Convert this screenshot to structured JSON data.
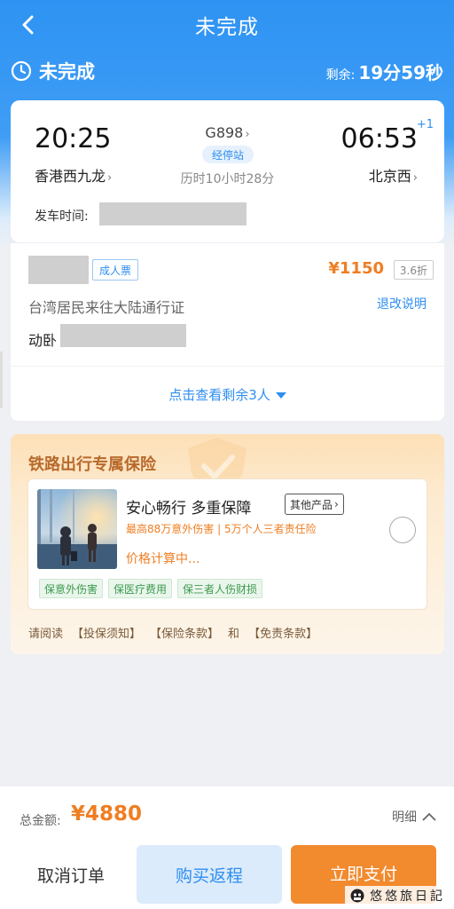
{
  "nav": {
    "title": "未完成"
  },
  "status": {
    "text": "未完成",
    "remaining_label": "剩余:",
    "remaining_value": "19分59秒"
  },
  "trip": {
    "depart_time": "20:25",
    "depart_station": "香港西九龙",
    "train_no": "G898",
    "stops_label": "经停站",
    "duration": "历时10小时28分",
    "arrive_time": "06:53",
    "arrive_day_offset": "+1",
    "arrive_station": "北京西",
    "depart_time_label": "发车时间:"
  },
  "passenger": {
    "ticket_type": "成人票",
    "price": "¥1150",
    "discount": "3.6折",
    "id_type": "台湾居民来往大陆通行证",
    "refund_label": "退改说明",
    "seat_type": "动卧",
    "more_label": "点击查看剩余3人"
  },
  "insurance": {
    "title": "铁路出行专属保险",
    "product_name": "安心畅行 多重保障",
    "other_label": "其他产品",
    "coverage": "最高88万意外伤害 | 5万个人三者责任险",
    "calc_text": "价格计算中...",
    "tags": [
      "保意外伤害",
      "保医疗费用",
      "保三者人伤财损"
    ],
    "read_prefix": "请阅读",
    "link1": "【投保须知】",
    "link2": "【保险条款】",
    "and": "和",
    "link3": "【免责条款】"
  },
  "footer": {
    "total_label": "总金额:",
    "total_value": "¥4880",
    "detail_label": "明细",
    "cancel_label": "取消订单",
    "return_label": "购买返程",
    "pay_label": "立即支付"
  },
  "watermark": {
    "text": "悠悠旅日記"
  },
  "colors": {
    "brand_blue": "#2e8ef0",
    "accent_orange": "#ef7e22",
    "pay_button": "#f28a2e"
  }
}
